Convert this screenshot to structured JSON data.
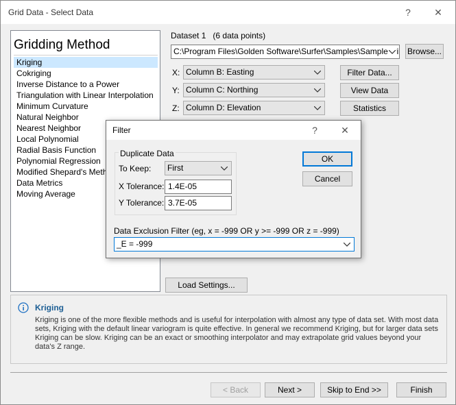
{
  "window": {
    "title": "Grid Data - Select Data",
    "help_glyph": "?",
    "close_glyph": "✕"
  },
  "gridding": {
    "heading": "Gridding Method",
    "methods": [
      "Kriging",
      "Cokriging",
      "Inverse Distance to a Power",
      "Triangulation with Linear Interpolation",
      "Minimum Curvature",
      "Natural Neighbor",
      "Nearest Neighbor",
      "Local Polynomial",
      "Radial Basis Function",
      "Polynomial Regression",
      "Modified Shepard's Method",
      "Data Metrics",
      "Moving Average"
    ],
    "selected_index": 0
  },
  "dataset": {
    "label": "Dataset 1",
    "points": "(6 data points)",
    "path": "C:\\Program Files\\Golden Software\\Surfer\\Samples\\SampleDrillhole",
    "browse_label": "Browse...",
    "x_label": "X:",
    "x_value": "Column B:  Easting",
    "y_label": "Y:",
    "y_value": "Column C:  Northing",
    "z_label": "Z:",
    "z_value": "Column D:  Elevation",
    "filter_label": "Filter Data...",
    "view_label": "View Data",
    "stats_label": "Statistics",
    "load_label": "Load Settings..."
  },
  "info": {
    "title": "Kriging",
    "icon": "info-icon",
    "text": "Kriging is one of the more flexible methods and is useful for interpolation with almost any type of data set. With most data sets, Kriging with the default linear variogram is quite effective. In general we recommend Kriging, but for larger data sets Kriging can be slow. Kriging can be an exact or smoothing interpolator and may extrapolate grid values beyond your data's Z range."
  },
  "footer": {
    "back_label": "< Back",
    "next_label": "Next >",
    "skip_label": "Skip to End >>",
    "finish_label": "Finish"
  },
  "filter_dialog": {
    "title": "Filter",
    "help_glyph": "?",
    "close_glyph": "✕",
    "group_label": "Duplicate Data",
    "keep_label": "To Keep:",
    "keep_value": "First",
    "xtol_label": "X Tolerance:",
    "xtol_value": "1.4E-05",
    "ytol_label": "Y Tolerance:",
    "ytol_value": "3.7E-05",
    "ok_label": "OK",
    "cancel_label": "Cancel",
    "exclusion_label": "Data Exclusion Filter  (eg, x = -999 OR y >= -999 OR z = -999)",
    "exclusion_value": "_E = -999"
  }
}
